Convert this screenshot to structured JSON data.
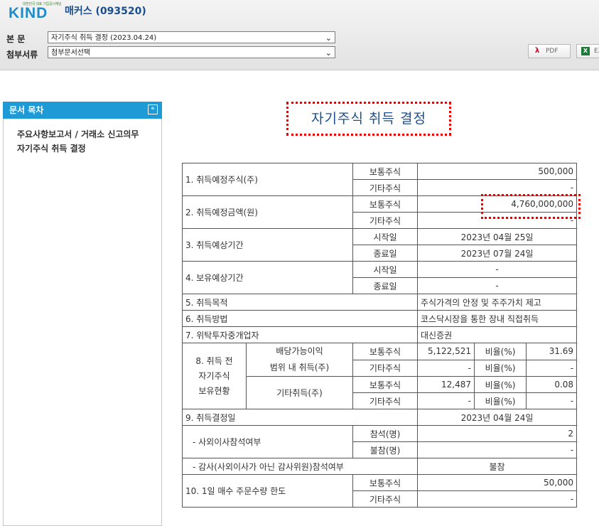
{
  "header": {
    "logo_tagline": "대한민국 대표 기업공시채널",
    "logo_text": "KIND",
    "company_title": "매커스 (093520)",
    "main_doc_label": "본 문",
    "main_doc_value": "자기주식 취득 결정 (2023.04.24)",
    "attach_label": "첨부서류",
    "attach_value": "첨부문서선택",
    "pdf_label": "PDF",
    "excel_label": "EX"
  },
  "toc": {
    "title": "문서 목차",
    "collapse_glyph": "«",
    "items": [
      "주요사항보고서 / 거래소 신고의무",
      "자기주식 취득 결정"
    ]
  },
  "doc_title": "자기주식 취득 결정",
  "table": {
    "r1": {
      "label": "1. 취득예정주식(주)",
      "sub1": "보통주식",
      "val1": "500,000",
      "sub2": "기타주식",
      "val2": "-"
    },
    "r2": {
      "label": "2. 취득예정금액(원)",
      "sub1": "보통주식",
      "val1": "4,760,000,000",
      "sub2": "기타주식",
      "val2": "-"
    },
    "r3": {
      "label": "3. 취득예상기간",
      "sub1": "시작일",
      "val1": "2023년 04월 25일",
      "sub2": "종료일",
      "val2": "2023년 07월 24일"
    },
    "r4": {
      "label": "4. 보유예상기간",
      "sub1": "시작일",
      "val1": "-",
      "sub2": "종료일",
      "val2": "-"
    },
    "r5": {
      "label": "5. 취득목적",
      "val": "주식가격의 안정 및 주주가치 제고"
    },
    "r6": {
      "label": "6. 취득방법",
      "val": "코스닥시장을 통한 장내 직접취득"
    },
    "r7": {
      "label": "7. 위탁투자중개업자",
      "val": "대신증권"
    },
    "r8": {
      "label_1": "8. 취득 전",
      "label_2": "자기주식",
      "label_3": "보유현황",
      "g1_1": "배당가능이익",
      "g1_2": "범위 내 취득(주)",
      "g2": "기타취득(주)",
      "common": "보통주식",
      "other": "기타주식",
      "ratio": "비율(%)",
      "g1_common_qty": "5,122,521",
      "g1_common_ratio": "31.69",
      "g1_other_qty": "-",
      "g1_other_ratio": "-",
      "g2_common_qty": "12,487",
      "g2_common_ratio": "0.08",
      "g2_other_qty": "-",
      "g2_other_ratio": "-"
    },
    "r9": {
      "label": "9. 취득결정일",
      "val": "2023년 04월 24일"
    },
    "r9a": {
      "label": "- 사외이사참석여부",
      "sub1": "참석(명)",
      "val1": "2",
      "sub2": "불참(명)",
      "val2": "-"
    },
    "r9b": {
      "label": "- 감사(사외이사가 아닌 감사위원)참석여부",
      "val": "불참"
    },
    "r10": {
      "label": "10. 1일 매수 주문수량 한도",
      "sub1": "보통주식",
      "val1": "50,000",
      "sub2": "기타주식",
      "val2": "-"
    }
  }
}
